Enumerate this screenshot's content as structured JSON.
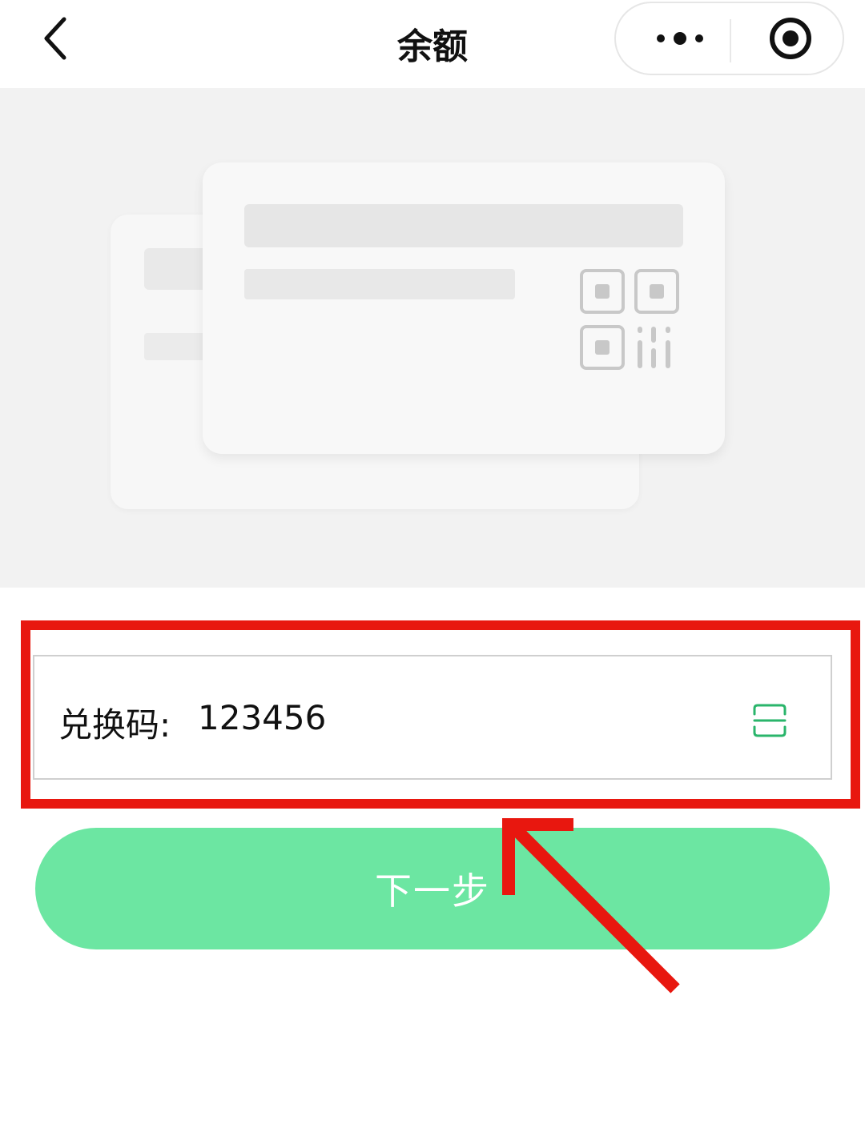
{
  "header": {
    "title": "余额",
    "back_icon": "chevron-left-icon",
    "more_icon": "more-dots-icon",
    "close_icon": "target-circle-icon"
  },
  "form": {
    "redeem_label": "兑换码:",
    "redeem_value": "123456",
    "scan_icon": "scan-icon",
    "scan_color": "#2ab56b"
  },
  "next_button": {
    "label": "下一步",
    "color": "#6ce6a2"
  },
  "annotation": {
    "color": "#e8170f"
  }
}
